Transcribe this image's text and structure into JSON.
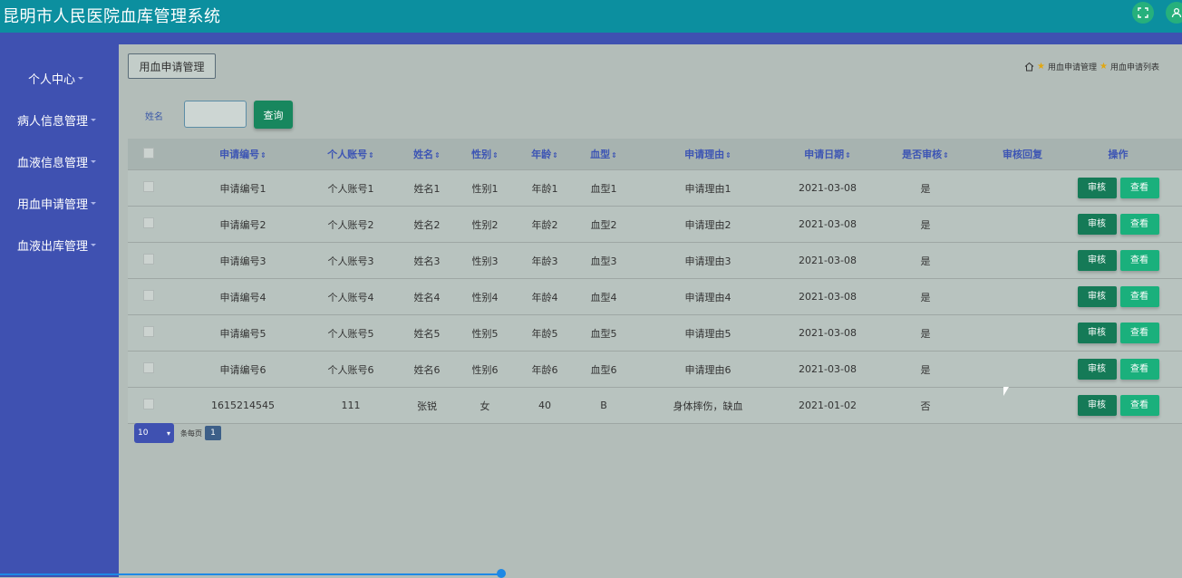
{
  "app": {
    "title": "昆明市人民医院血库管理系统"
  },
  "sidebar": {
    "items": [
      {
        "label": "个人中心"
      },
      {
        "label": "病人信息管理"
      },
      {
        "label": "血液信息管理"
      },
      {
        "label": "用血申请管理"
      },
      {
        "label": "血液出库管理"
      }
    ]
  },
  "page": {
    "tab_label": "用血申请管理",
    "breadcrumb": [
      "用血申请管理",
      "用血申请列表"
    ]
  },
  "search": {
    "label": "姓名",
    "value": "",
    "button": "查询"
  },
  "table": {
    "headers": [
      "申请编号",
      "个人账号",
      "姓名",
      "性别",
      "年龄",
      "血型",
      "申请理由",
      "申请日期",
      "是否审核",
      "审核回复",
      "操作"
    ],
    "sort_marker": "⇕",
    "review_label": "审核",
    "view_label": "查看",
    "rows": [
      {
        "id": "申请编号1",
        "account": "个人账号1",
        "name": "姓名1",
        "gender": "性别1",
        "age": "年龄1",
        "blood": "血型1",
        "reason": "申请理由1",
        "date": "2021-03-08",
        "reviewed": "是",
        "reply": ""
      },
      {
        "id": "申请编号2",
        "account": "个人账号2",
        "name": "姓名2",
        "gender": "性别2",
        "age": "年龄2",
        "blood": "血型2",
        "reason": "申请理由2",
        "date": "2021-03-08",
        "reviewed": "是",
        "reply": ""
      },
      {
        "id": "申请编号3",
        "account": "个人账号3",
        "name": "姓名3",
        "gender": "性别3",
        "age": "年龄3",
        "blood": "血型3",
        "reason": "申请理由3",
        "date": "2021-03-08",
        "reviewed": "是",
        "reply": ""
      },
      {
        "id": "申请编号4",
        "account": "个人账号4",
        "name": "姓名4",
        "gender": "性别4",
        "age": "年龄4",
        "blood": "血型4",
        "reason": "申请理由4",
        "date": "2021-03-08",
        "reviewed": "是",
        "reply": ""
      },
      {
        "id": "申请编号5",
        "account": "个人账号5",
        "name": "姓名5",
        "gender": "性别5",
        "age": "年龄5",
        "blood": "血型5",
        "reason": "申请理由5",
        "date": "2021-03-08",
        "reviewed": "是",
        "reply": ""
      },
      {
        "id": "申请编号6",
        "account": "个人账号6",
        "name": "姓名6",
        "gender": "性别6",
        "age": "年龄6",
        "blood": "血型6",
        "reason": "申请理由6",
        "date": "2021-03-08",
        "reviewed": "是",
        "reply": ""
      },
      {
        "id": "1615214545",
        "account": "111",
        "name": "张锐",
        "gender": "女",
        "age": "40",
        "blood": "B",
        "reason": "身体摔伤，缺血",
        "date": "2021-01-02",
        "reviewed": "否",
        "reply": ""
      }
    ]
  },
  "pager": {
    "page_size": "10",
    "per_page_text": "条每页",
    "current_page": "1"
  },
  "icons": {
    "fullscreen": "fullscreen-icon",
    "user": "user-icon",
    "home": "home-icon",
    "star": "star-icon",
    "checkbox": "checkbox-icon"
  },
  "colors": {
    "topbar": "#0c8f9f",
    "sidebar": "#3f51b1",
    "review_button": "#157a57",
    "view_button": "#1ab07c"
  }
}
